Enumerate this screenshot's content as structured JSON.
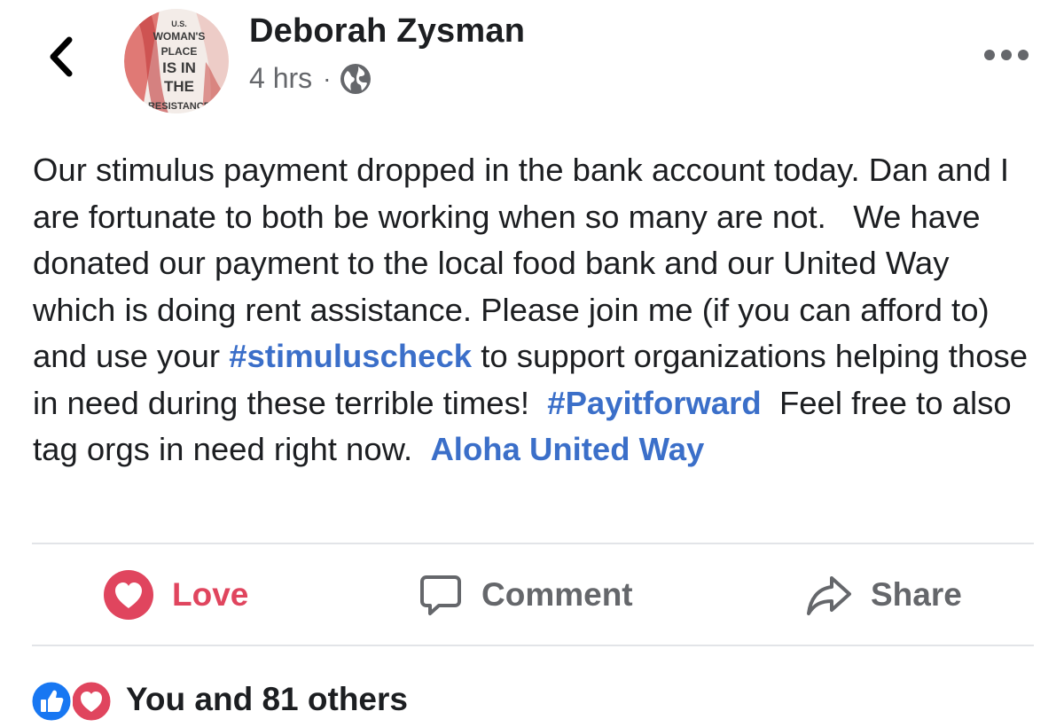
{
  "header": {
    "author_name": "Deborah Zysman",
    "timestamp": "4 hrs",
    "separator": "·",
    "privacy_icon": "globe-icon",
    "back_icon": "chevron-left-icon",
    "more_icon": "more-options-icon"
  },
  "avatar": {
    "lines": [
      "U.S.",
      "WOMAN'S",
      "PLACE",
      "IS IN",
      "THE",
      "RESISTANCE"
    ]
  },
  "post": {
    "segments": [
      {
        "text": "Our stimulus payment dropped in the bank account today. Dan and I are fortunate to both be working when so many are not.   We have donated our payment to the local food bank and our United Way which is doing rent assistance. Please join me (if you can afford to) and use your ",
        "link": false
      },
      {
        "text": "#stimuluscheck",
        "link": true
      },
      {
        "text": " to support organizations helping those in need during these terrible times!  ",
        "link": false
      },
      {
        "text": "#Payitforward",
        "link": true
      },
      {
        "text": "  Feel free to also tag orgs in need right now.  ",
        "link": false
      },
      {
        "text": "Aloha United Way",
        "link": true
      }
    ]
  },
  "actions": {
    "love": {
      "label": "Love",
      "icon": "heart-filled-icon"
    },
    "comment": {
      "label": "Comment",
      "icon": "comment-icon"
    },
    "share": {
      "label": "Share",
      "icon": "share-icon"
    }
  },
  "reactions": {
    "icons": [
      "like-icon",
      "heart-icon"
    ],
    "summary": "You and 81 others"
  },
  "colors": {
    "link": "#3b6fc9",
    "love": "#e0455e",
    "like_blue": "#1877f2",
    "muted": "#65676b",
    "divider": "#e2e4e8"
  }
}
